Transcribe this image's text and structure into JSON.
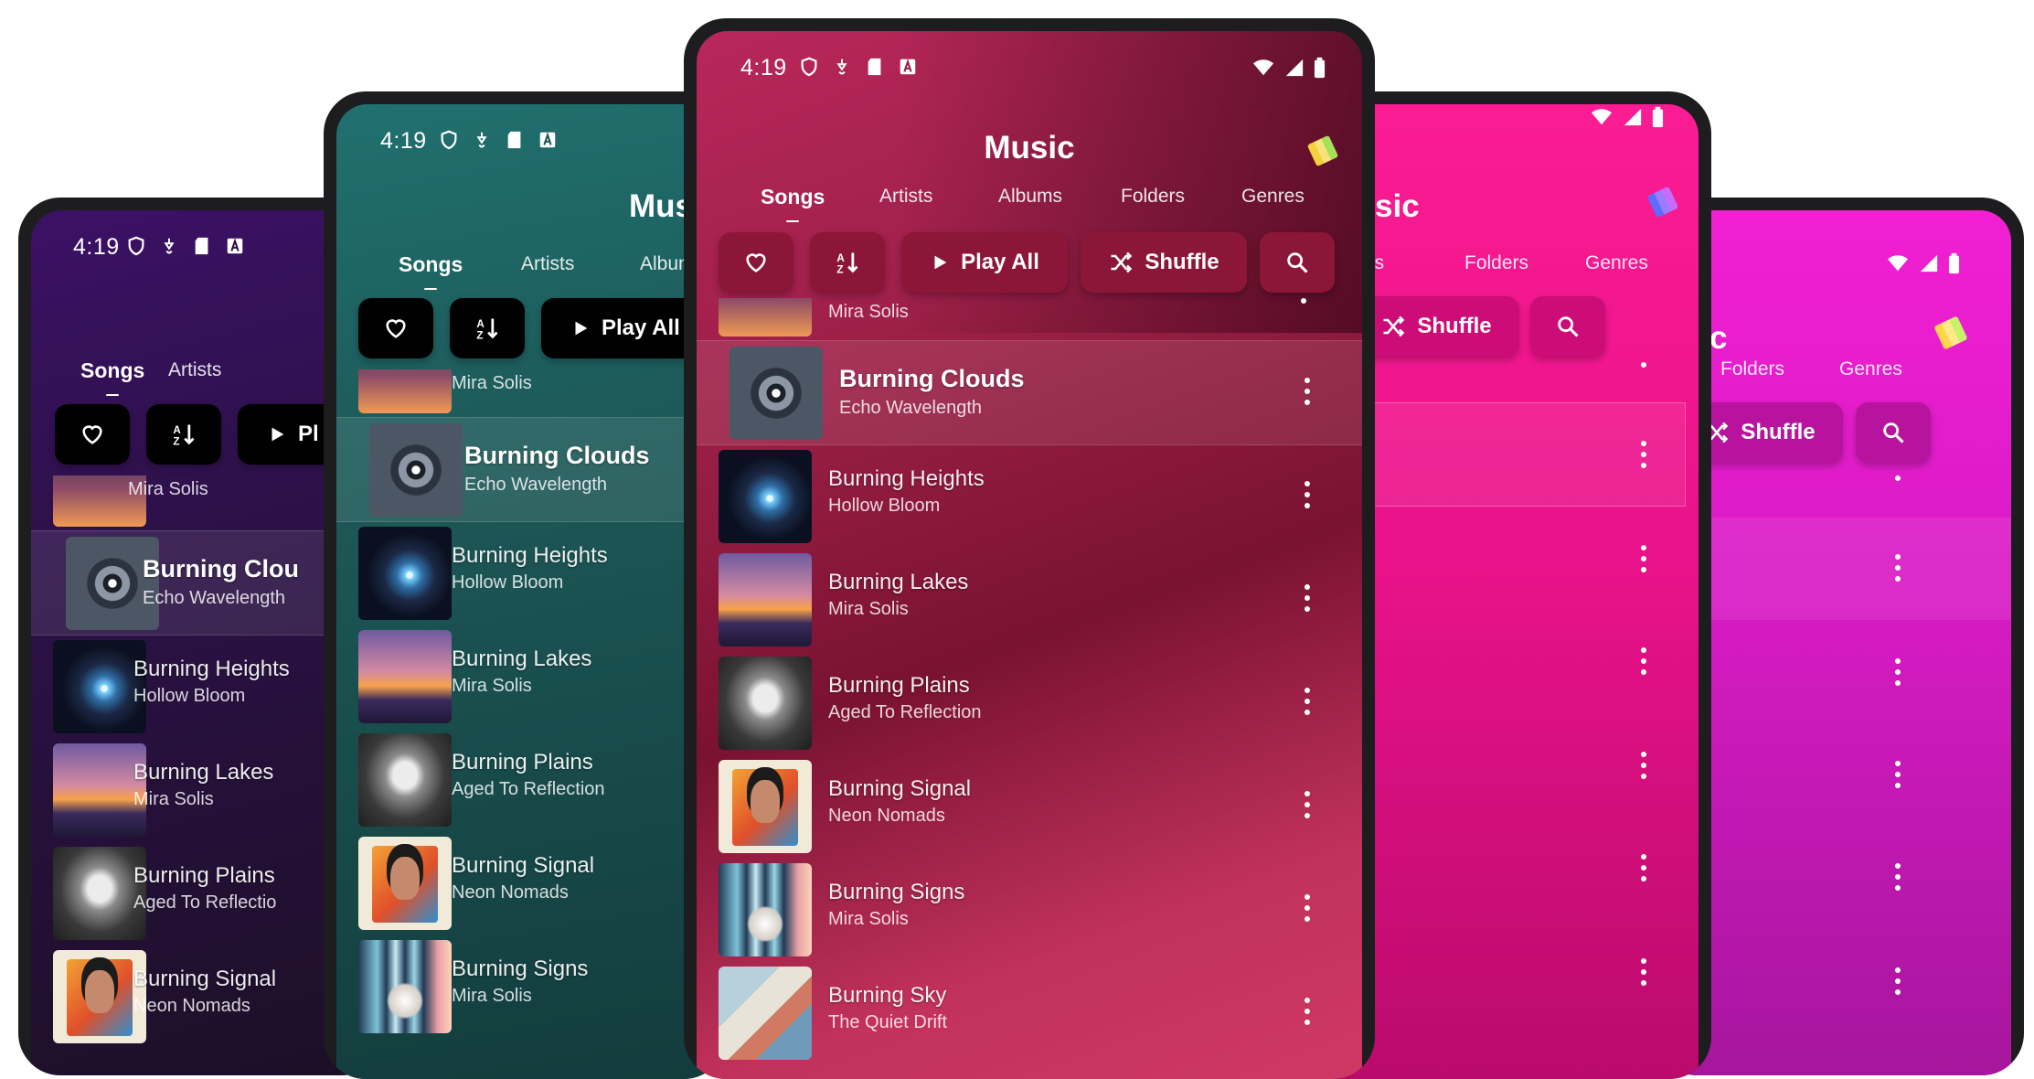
{
  "status": {
    "time": "4:19"
  },
  "app": {
    "title": "Music",
    "tabs": [
      "Songs",
      "Artists",
      "Albums",
      "Folders",
      "Genres"
    ]
  },
  "toolbar": {
    "play_all": "Play All",
    "shuffle": "Shuffle"
  },
  "partial": {
    "title_p2": "Mus",
    "title_p4": "sic",
    "title_p5": "c",
    "tab_albums_p2": "Album",
    "tab_albums_p4": "ns",
    "play_all_p1": "Pl",
    "current_title_p1": "Burning Clou",
    "current_artist_p1": "Echo Wavelength",
    "plains_artist_p1": "Aged To Reflectio"
  },
  "songs": [
    {
      "title": "",
      "artist": "Mira Solis",
      "art": "mira"
    },
    {
      "title": "Burning Clouds",
      "artist": "Echo Wavelength",
      "art": "clouds",
      "current": true
    },
    {
      "title": "Burning Heights",
      "artist": "Hollow Bloom",
      "art": "heights"
    },
    {
      "title": "Burning Lakes",
      "artist": "Mira Solis",
      "art": "lakes"
    },
    {
      "title": "Burning Plains",
      "artist": "Aged To Reflection",
      "art": "plains"
    },
    {
      "title": "Burning Signal",
      "artist": "Neon Nomads",
      "art": "signal"
    },
    {
      "title": "Burning Signs",
      "artist": "Mira Solis",
      "art": "signs"
    },
    {
      "title": "Burning Sky",
      "artist": "The Quiet Drift",
      "art": "sky"
    }
  ],
  "themes": {
    "purple": "#3a1657",
    "teal": "#1f5f61",
    "crimson": "#a6204a",
    "pink": "#f0168b",
    "magenta": "#e019c8"
  }
}
